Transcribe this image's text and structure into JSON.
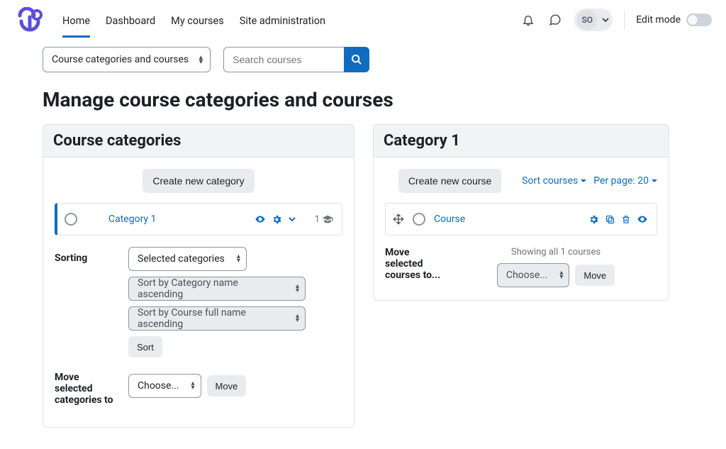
{
  "nav": {
    "items": [
      "Home",
      "Dashboard",
      "My courses",
      "Site administration"
    ],
    "active_index": 0
  },
  "topbar": {
    "user_initials": "SO",
    "edit_mode_label": "Edit mode"
  },
  "topcontrols": {
    "dropdown_label": "Course categories and courses",
    "search_placeholder": "Search courses"
  },
  "page_title": "Manage course categories and courses",
  "left": {
    "heading": "Course categories",
    "create_btn": "Create new category",
    "category_name": "Category 1",
    "category_count": "1",
    "sorting_label": "Sorting",
    "sort_scope": "Selected categories",
    "sort_cat": "Sort by Category name ascending",
    "sort_course": "Sort by Course full name ascending",
    "sort_btn": "Sort",
    "move_label": "Move selected categories to",
    "move_choose": "Choose...",
    "move_btn": "Move"
  },
  "right": {
    "heading": "Category 1",
    "create_btn": "Create new course",
    "sort_link": "Sort courses",
    "perpage_link": "Per page: 20",
    "course_name": "Course",
    "showing_text": "Showing all 1 courses",
    "move_label": "Move selected courses to...",
    "move_choose": "Choose...",
    "move_btn": "Move"
  }
}
